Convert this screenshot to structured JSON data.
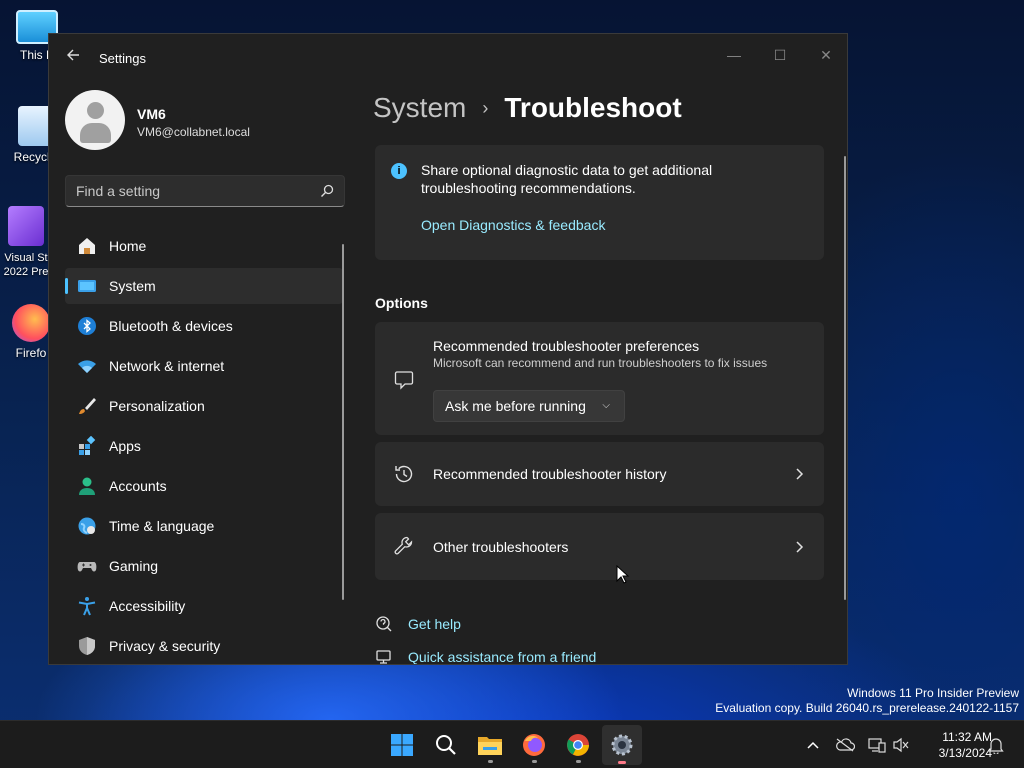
{
  "desktop": {
    "icons": [
      {
        "label": "This P"
      },
      {
        "label": "Recycle"
      },
      {
        "label": "Visual St 2022 Pre"
      },
      {
        "label": "Firefo"
      }
    ]
  },
  "window": {
    "title": "Settings",
    "controls": {
      "minimize": "—",
      "maximize": "☐",
      "close": "✕"
    }
  },
  "profile": {
    "name": "VM6",
    "email": "VM6@collabnet.local"
  },
  "search": {
    "placeholder": "Find a setting"
  },
  "sidebar": {
    "items": [
      {
        "label": "Home",
        "icon": "home-icon"
      },
      {
        "label": "System",
        "icon": "system-icon",
        "selected": true
      },
      {
        "label": "Bluetooth & devices",
        "icon": "bluetooth-icon"
      },
      {
        "label": "Network & internet",
        "icon": "wifi-icon"
      },
      {
        "label": "Personalization",
        "icon": "brush-icon"
      },
      {
        "label": "Apps",
        "icon": "apps-icon"
      },
      {
        "label": "Accounts",
        "icon": "accounts-icon"
      },
      {
        "label": "Time & language",
        "icon": "globe-icon"
      },
      {
        "label": "Gaming",
        "icon": "gamepad-icon"
      },
      {
        "label": "Accessibility",
        "icon": "accessibility-icon"
      },
      {
        "label": "Privacy & security",
        "icon": "shield-icon"
      }
    ]
  },
  "breadcrumb": {
    "parent": "System",
    "separator": "›",
    "current": "Troubleshoot"
  },
  "info_card": {
    "text": "Share optional diagnostic data to get additional troubleshooting recommendations.",
    "link": "Open Diagnostics & feedback"
  },
  "options": {
    "title": "Options",
    "preferences": {
      "title": "Recommended troubleshooter preferences",
      "subtitle": "Microsoft can recommend and run troubleshooters to fix issues",
      "dropdown_value": "Ask me before running"
    },
    "history": {
      "title": "Recommended troubleshooter history"
    },
    "other": {
      "title": "Other troubleshooters"
    }
  },
  "help_links": {
    "get_help": "Get help",
    "quick_assist": "Quick assistance from a friend"
  },
  "watermark": {
    "line1": "Windows 11 Pro Insider Preview",
    "line2": "Evaluation copy. Build 26040.rs_prerelease.240122-1157"
  },
  "taskbar": {
    "apps": [
      "start-icon",
      "search-icon",
      "file-explorer-icon",
      "firefox-icon",
      "chrome-icon",
      "settings-icon"
    ],
    "clock": {
      "time": "11:32 AM",
      "date": "3/13/2024"
    }
  },
  "colors": {
    "accent": "#4cc2ff",
    "link": "#99ebff",
    "window_bg": "#202020",
    "card_bg": "#2b2b2b"
  }
}
